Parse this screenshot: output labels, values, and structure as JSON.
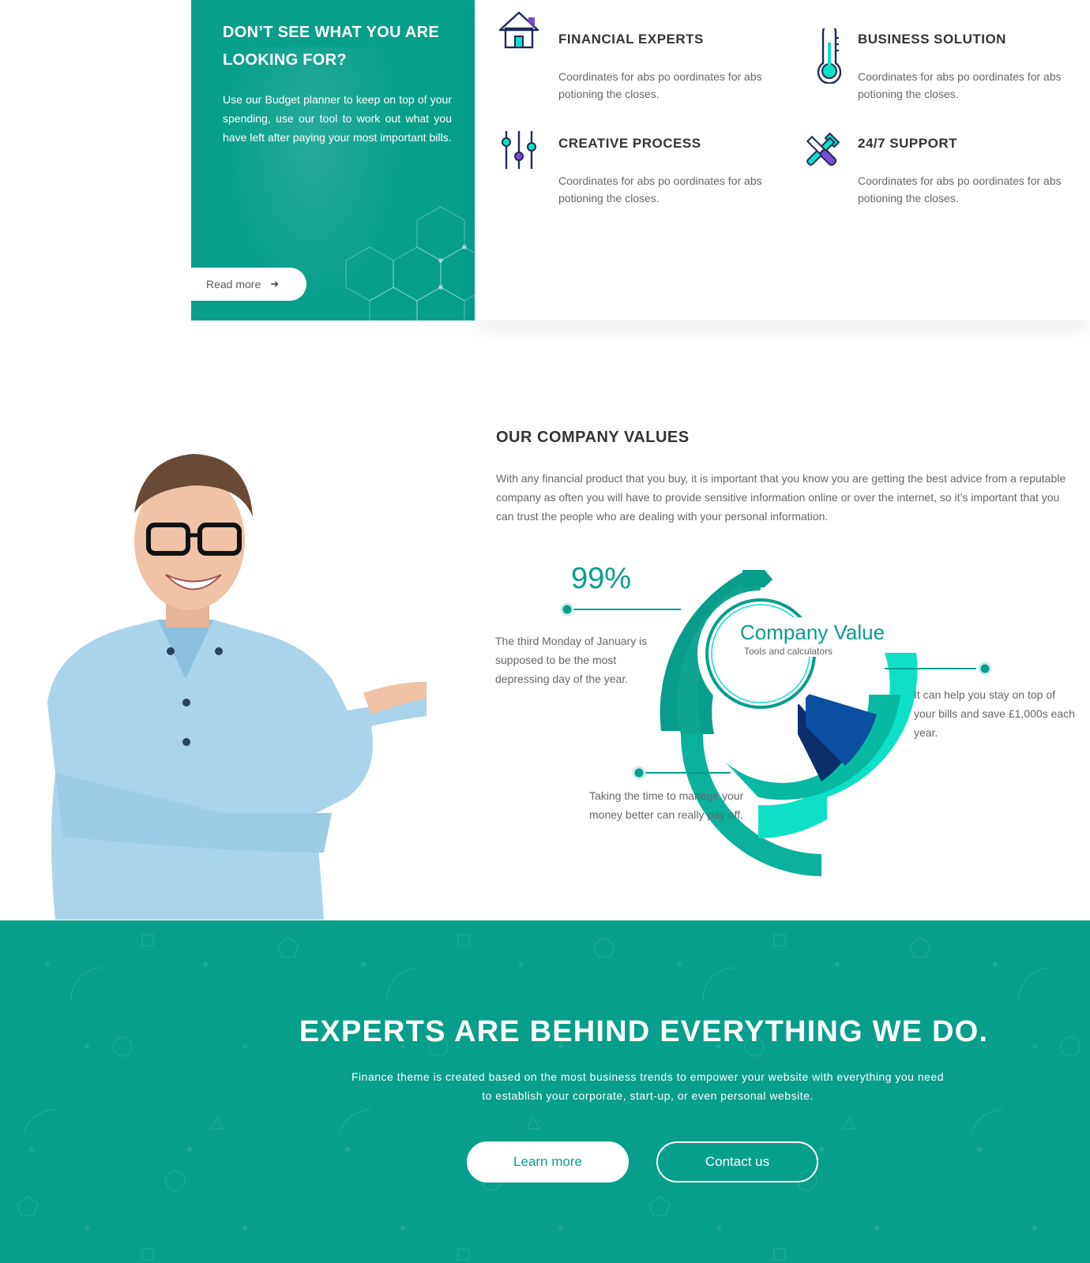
{
  "promo": {
    "title": "DON’T SEE WHAT YOU ARE LOOKING FOR?",
    "text": "Use our Budget planner to keep on top of your spending, use our tool to work out what you have left after paying your most important bills.",
    "read_more_label": "Read more",
    "read_more_icon": "arrow-right-icon"
  },
  "features": [
    {
      "icon": "house-icon",
      "title": "FINANCIAL EXPERTS",
      "text": "Coordinates for abs po oordinates for abs potioning the closes."
    },
    {
      "icon": "thermometer-icon",
      "title": "BUSINESS SOLUTION",
      "text": "Coordinates for abs po oordinates for abs potioning the closes."
    },
    {
      "icon": "sliders-icon",
      "title": "CREATIVE PROCESS",
      "text": "Coordinates for abs po oordinates for abs potioning the closes."
    },
    {
      "icon": "tools-icon",
      "title": "24/7 SUPPORT",
      "text": "Coordinates for abs po oordinates for abs potioning the closes."
    }
  ],
  "values": {
    "title": "OUR COMPANY VALUES",
    "text": "With any financial product that you buy, it is important that you know you are getting the best advice from a reputable company as often you will have to provide sensitive information online or over the internet, so it’s important that you can trust the people who are dealing with your personal information."
  },
  "chart_data": {
    "type": "pie",
    "title": "Company Value",
    "subtitle": "Tools and calculators",
    "highlight_value": "99%",
    "callouts": [
      "The third Monday of January is supposed to be the most depressing day of the year.",
      "It can help you stay on top of your bills and save £1,000s each year.",
      "Taking the time to manage your money better can really pay off."
    ]
  },
  "cta": {
    "title": "EXPERTS ARE BEHIND EVERYTHING WE DO.",
    "text": "Finance theme is created based on the most business trends to empower your website with everything you need to establish your corporate, start-up, or even personal website.",
    "learn_label": "Learn more",
    "contact_label": "Contact us"
  },
  "colors": {
    "brand": "#079e8c",
    "accent_light": "#0ee0c8",
    "accent_dark": "#0a4fa0",
    "icon_purple": "#7b4bd6"
  }
}
